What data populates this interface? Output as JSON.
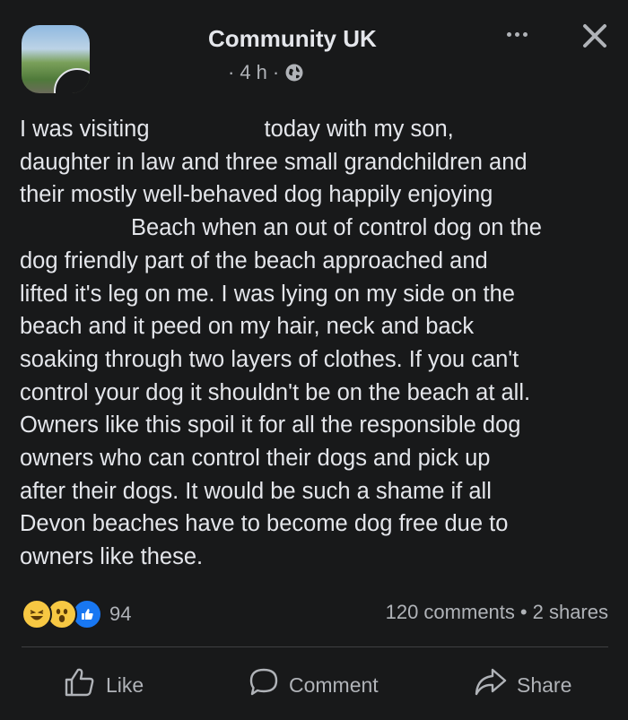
{
  "post": {
    "page_name": "Community UK",
    "time": "4 h",
    "meta_dot": "·",
    "text_lines": {
      "l1a": "I was visiting",
      "l1b": "today with my son,",
      "l2": "daughter in law and three small grandchildren and",
      "l3": "their mostly well-behaved dog happily enjoying",
      "l4": "Beach when an out of control dog on the",
      "l5": "dog friendly part of the beach approached and",
      "l6": "lifted it's leg on me. I was lying on my side on the",
      "l7": "beach and it peed on my hair, neck and back",
      "l8": "soaking through two layers of clothes. If you can't",
      "l9": "control your dog it shouldn't be on the beach at all.",
      "l10": "Owners like this spoil it for all the responsible dog",
      "l11": "owners who can control their dogs and pick up",
      "l12": "after their dogs. It would be such a shame if all",
      "l13": "Devon beaches have to become dog free due to",
      "l14": "owners like these."
    }
  },
  "engagement": {
    "reaction_count": "94",
    "comments": "120 comments",
    "separator": "•",
    "shares": "2 shares"
  },
  "actions": {
    "like": "Like",
    "comment": "Comment",
    "share": "Share"
  },
  "icons": {
    "more": "more-icon",
    "close": "close-icon",
    "globe": "globe-icon",
    "like": "thumbs-up-icon",
    "comment": "comment-icon",
    "share": "share-icon"
  },
  "colors": {
    "background": "#18191a",
    "text": "#e4e6eb",
    "secondary": "#b0b3b8",
    "like_blue": "#1877f2",
    "reaction_yellow": "#f7c843"
  }
}
